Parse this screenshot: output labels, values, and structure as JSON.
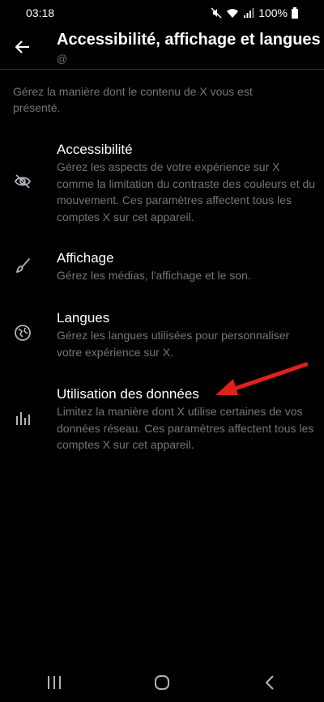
{
  "status": {
    "time": "03:18",
    "battery": "100%"
  },
  "header": {
    "title": "Accessibilité, affichage et langues",
    "subtitle": "@"
  },
  "intro": "Gérez la manière dont le contenu de X vous est présenté.",
  "items": [
    {
      "icon": "eye-slash-icon",
      "title": "Accessibilité",
      "description": "Gérez les aspects de votre expérience sur X comme la limitation du contraste des couleurs et du mouvement. Ces paramètres affectent tous les comptes X sur cet appareil."
    },
    {
      "icon": "brush-icon",
      "title": "Affichage",
      "description": "Gérez les médias, l'affichage et le son."
    },
    {
      "icon": "globe-icon",
      "title": "Langues",
      "description": "Gérez les langues utilisées pour personnaliser votre expérience sur X."
    },
    {
      "icon": "bar-chart-icon",
      "title": "Utilisation des données",
      "description": "Limitez la manière dont X utilise certaines de vos données réseau. Ces paramètres affectent tous les comptes X sur cet appareil."
    }
  ],
  "colors": {
    "background": "#000000",
    "text": "#e7e9ea",
    "secondary": "#71767b",
    "annotation": "#e0201b"
  }
}
